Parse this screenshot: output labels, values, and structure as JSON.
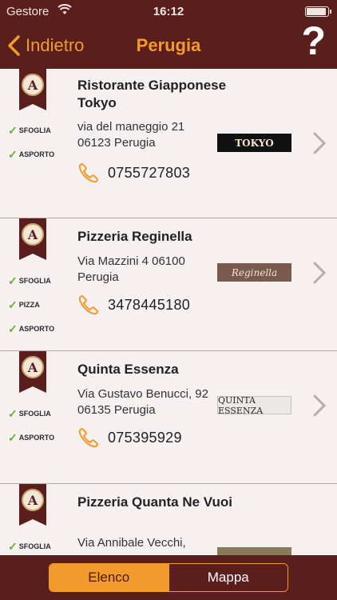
{
  "status_bar": {
    "carrier": "Gestore",
    "time": "16:12"
  },
  "nav": {
    "back_label": "Indietro",
    "title": "Perugia",
    "help_label": "?"
  },
  "restaurants": [
    {
      "name": "Ristorante Giapponese Tokyo",
      "address": "via del maneggio 21 06123 Perugia",
      "phone": "0755727803",
      "features": [
        "SFOGLIA",
        "ASPORTO"
      ],
      "logo_text": "TOKYO"
    },
    {
      "name": "Pizzeria Reginella",
      "address": "Via Mazzini 4 06100 Perugia",
      "phone": "3478445180",
      "features": [
        "SFOGLIA",
        "PIZZA",
        "ASPORTO"
      ],
      "logo_text": "Reginella"
    },
    {
      "name": "Quinta Essenza",
      "address": "Via Gustavo Benucci, 92 06135 Perugia",
      "phone": "075395929",
      "features": [
        "SFOGLIA",
        "ASPORTO"
      ],
      "logo_text": "QUINTA ESSENZA"
    },
    {
      "name": "Pizzeria Quanta Ne Vuoi",
      "address": "Via Annibale Vecchi,",
      "phone": "",
      "features": [
        "SFOGLIA"
      ],
      "logo_text": ""
    }
  ],
  "segmented": {
    "list_label": "Elenco",
    "map_label": "Mappa"
  },
  "colors": {
    "bar": "#5a1f1c",
    "accent": "#f39a2c",
    "check": "#6cae2a"
  }
}
